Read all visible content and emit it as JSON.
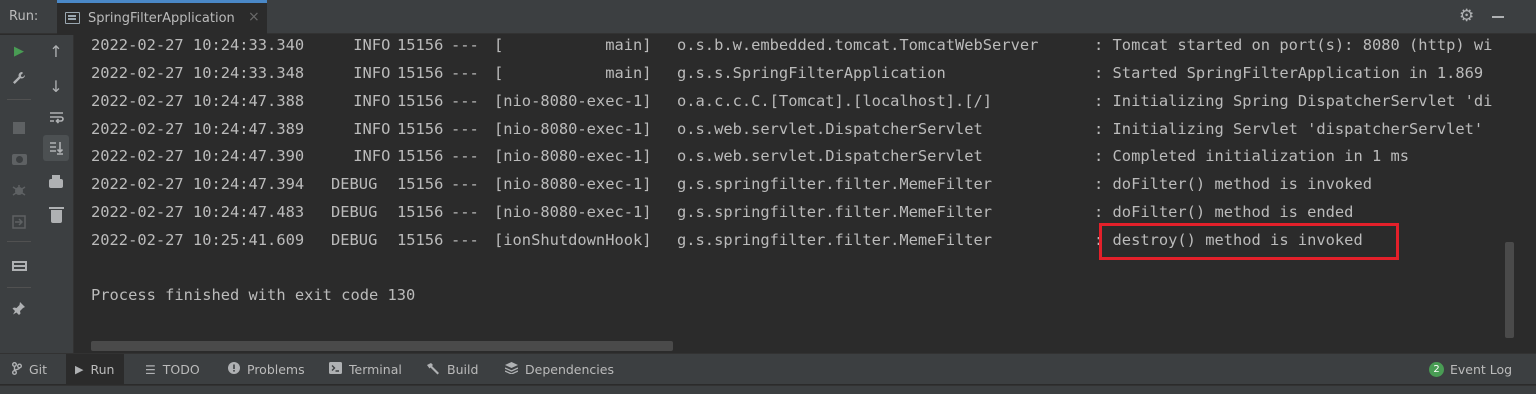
{
  "header": {
    "run_label": "Run:",
    "tab_title": "SpringFilterApplication",
    "tab_close": "×",
    "settings_icon": "gear-icon",
    "minimize_icon": "minimize-icon"
  },
  "left_toolbar": {
    "icons": [
      "rerun-icon",
      "up-arrow-icon",
      "wrench-icon",
      "down-arrow-icon",
      "stop-icon",
      "soft-wrap-icon",
      "camera-icon",
      "scroll-to-end-icon",
      "debug-icon",
      "print-icon",
      "exit-icon",
      "trash-icon",
      "layout-icon",
      "pin-icon"
    ],
    "glyphs": {
      "run": "▶",
      "up": "↑",
      "wrench": "🔧",
      "down": "↓",
      "soft_wrap": "⮐",
      "scroll_end": "⇊",
      "debug": "✱",
      "exit": "⇥",
      "pin": "📌"
    }
  },
  "console": {
    "lines": [
      {
        "ts": "2022-02-27 10:24:33.340",
        "level": " INFO",
        "pid": "15156",
        "sep": "---",
        "thread": "[           main]",
        "logger": "o.s.b.w.embedded.tomcat.TomcatWebServer",
        "msg": ": Tomcat started on port(s): 8080 (http) wi"
      },
      {
        "ts": "2022-02-27 10:24:33.348",
        "level": " INFO",
        "pid": "15156",
        "sep": "---",
        "thread": "[           main]",
        "logger": "g.s.s.SpringFilterApplication",
        "msg": ": Started SpringFilterApplication in 1.869"
      },
      {
        "ts": "2022-02-27 10:24:47.388",
        "level": " INFO",
        "pid": "15156",
        "sep": "---",
        "thread": "[nio-8080-exec-1]",
        "logger": "o.a.c.c.C.[Tomcat].[localhost].[/]",
        "msg": ": Initializing Spring DispatcherServlet 'di"
      },
      {
        "ts": "2022-02-27 10:24:47.389",
        "level": " INFO",
        "pid": "15156",
        "sep": "---",
        "thread": "[nio-8080-exec-1]",
        "logger": "o.s.web.servlet.DispatcherServlet",
        "msg": ": Initializing Servlet 'dispatcherServlet'"
      },
      {
        "ts": "2022-02-27 10:24:47.390",
        "level": " INFO",
        "pid": "15156",
        "sep": "---",
        "thread": "[nio-8080-exec-1]",
        "logger": "o.s.web.servlet.DispatcherServlet",
        "msg": ": Completed initialization in 1 ms"
      },
      {
        "ts": "2022-02-27 10:24:47.394",
        "level": "DEBUG",
        "pid": "15156",
        "sep": "---",
        "thread": "[nio-8080-exec-1]",
        "logger": "g.s.springfilter.filter.MemeFilter",
        "msg": ": doFilter() method is invoked"
      },
      {
        "ts": "2022-02-27 10:24:47.483",
        "level": "DEBUG",
        "pid": "15156",
        "sep": "---",
        "thread": "[nio-8080-exec-1]",
        "logger": "g.s.springfilter.filter.MemeFilter",
        "msg": ": doFilter() method is ended"
      },
      {
        "ts": "2022-02-27 10:25:41.609",
        "level": "DEBUG",
        "pid": "15156",
        "sep": "---",
        "thread": "[ionShutdownHook]",
        "logger": "g.s.springfilter.filter.MemeFilter",
        "msg": ": destroy() method is invoked"
      }
    ],
    "exit_message": "Process finished with exit code 130",
    "highlight_color": "#e3202a"
  },
  "bottom_tabs": [
    {
      "icon": "git-branch-icon",
      "glyph": "ᚹ",
      "label": "Git"
    },
    {
      "icon": "run-icon",
      "glyph": "▶",
      "label": "Run",
      "active": true
    },
    {
      "icon": "todo-list-icon",
      "glyph": "☰",
      "label": "TODO"
    },
    {
      "icon": "problems-icon",
      "glyph": "●",
      "label": "Problems"
    },
    {
      "icon": "terminal-icon",
      "glyph": "▣",
      "label": "Terminal"
    },
    {
      "icon": "build-hammer-icon",
      "glyph": "⚒",
      "label": "Build"
    },
    {
      "icon": "dependencies-icon",
      "glyph": "◈",
      "label": "Dependencies"
    }
  ],
  "event_log": {
    "count": "2",
    "label": "Event Log"
  },
  "colors": {
    "background": "#2b2b2b",
    "panel": "#3c3f41",
    "accent": "#4a88c7",
    "run_green": "#499c54",
    "highlight_red": "#e3202a"
  }
}
